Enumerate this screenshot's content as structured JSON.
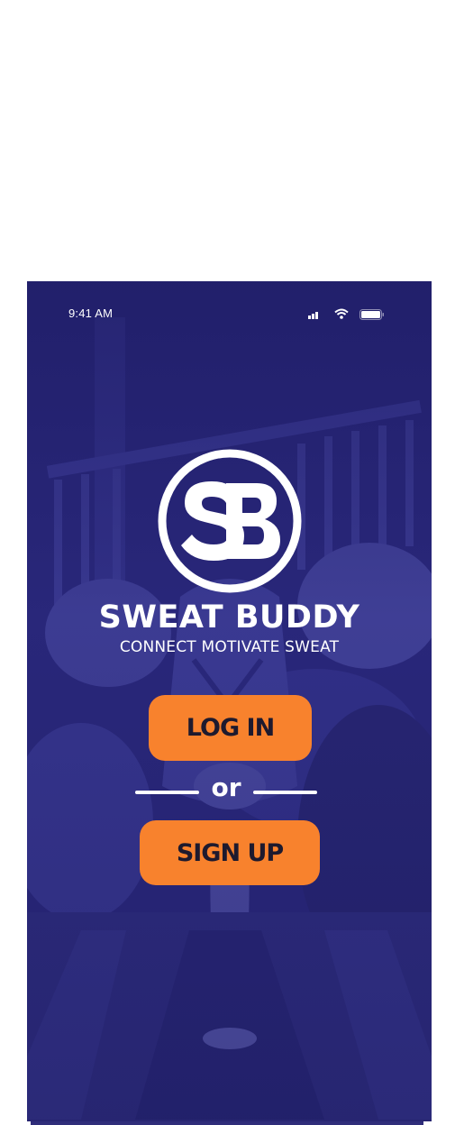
{
  "status_bar": {
    "time": "9:41 AM",
    "icons": [
      "cellular-signal-icon",
      "wifi-icon",
      "battery-icon"
    ]
  },
  "brand": {
    "logo_monogram": "SB",
    "title": "SWEAT BUDDY",
    "tagline": "CONNECT MOTIVATE SWEAT"
  },
  "actions": {
    "login_label": "LOG IN",
    "divider_label": "or",
    "signup_label": "SIGN UP"
  },
  "colors": {
    "accent": "#f8822d",
    "overlay": "#23226a",
    "text_on_accent": "#1e1a2e",
    "text": "#ffffff"
  }
}
